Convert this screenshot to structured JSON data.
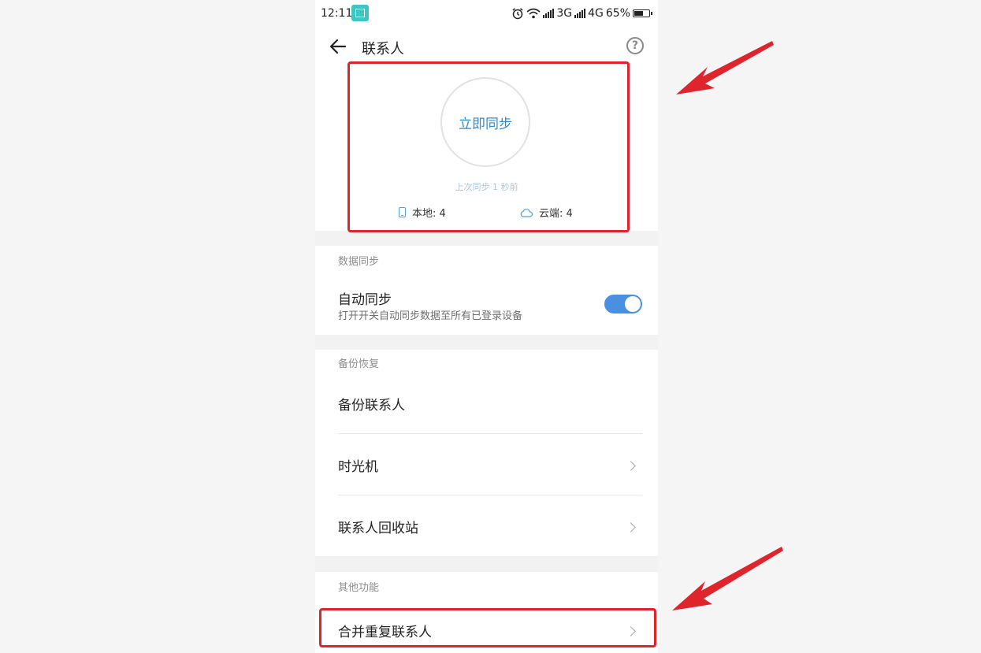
{
  "status_bar": {
    "time": "12:11",
    "net1": "3G",
    "net2": "4G",
    "battery": "65%",
    "battery_level": 0.65
  },
  "header": {
    "title": "联系人",
    "back_icon": "arrow-left-icon",
    "help_icon": "question-circle-icon",
    "help_glyph": "?"
  },
  "sync": {
    "button_label": "立即同步",
    "last_sync": "上次同步 1 秒前",
    "local_label": "本地: 4",
    "cloud_label": "云端: 4"
  },
  "data_sync": {
    "section_title": "数据同步",
    "auto_sync_label": "自动同步",
    "auto_sync_desc": "打开开关自动同步数据至所有已登录设备",
    "auto_sync_on": true
  },
  "backup": {
    "section_title": "备份恢复",
    "items": [
      {
        "label": "备份联系人"
      },
      {
        "label": "时光机"
      },
      {
        "label": "联系人回收站"
      }
    ]
  },
  "other": {
    "section_title": "其他功能",
    "items": [
      {
        "label": "合并重复联系人"
      }
    ]
  },
  "colors": {
    "accent_blue": "#2e8bd6",
    "toggle_on": "#4a90e2",
    "highlight_red": "#e0242c"
  }
}
